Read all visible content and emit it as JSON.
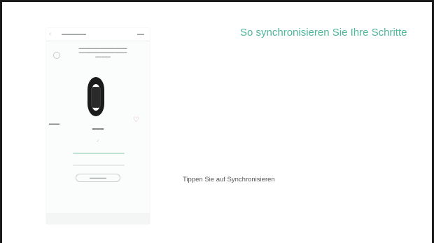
{
  "slide": {
    "title": "So synchronisieren Sie Ihre Schritte",
    "caption": "Tippen Sie auf Synchronisieren"
  },
  "colors": {
    "title": "#4fb79a",
    "caption": "#555555",
    "border": "#1a1a1a"
  },
  "phone": {
    "icon": "tracker-band",
    "bars": [
      {
        "color": "#bfe2d3"
      },
      {
        "color": "#e6e9e8"
      }
    ]
  }
}
